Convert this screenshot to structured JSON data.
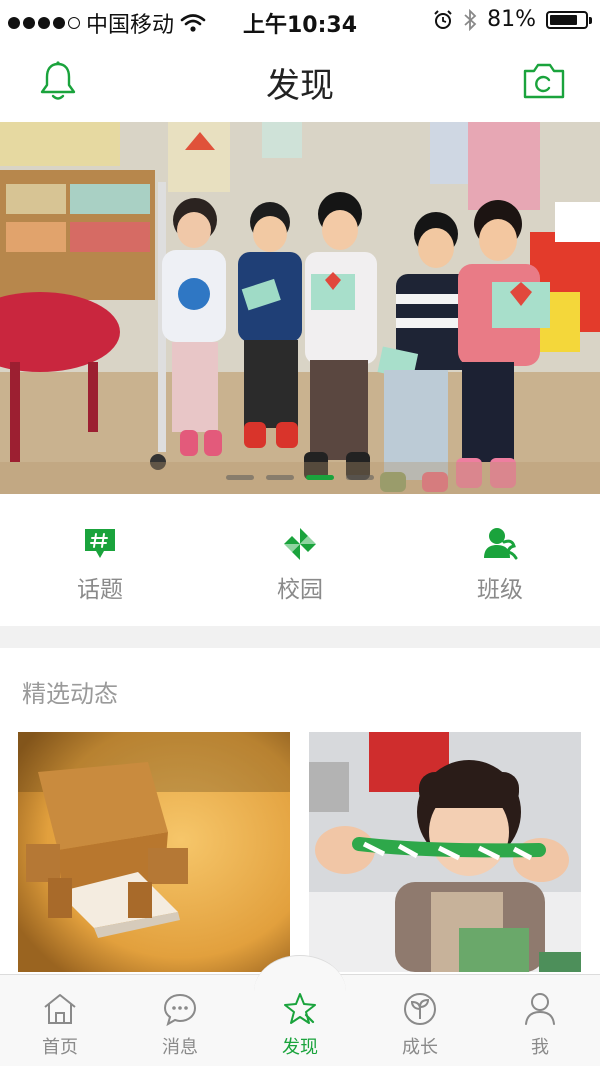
{
  "status_bar": {
    "carrier": "中国移动",
    "time": "上午10:34",
    "battery_percent": "81%",
    "battery_level": 0.81,
    "signal_bars_filled": 4,
    "signal_bars_total": 5
  },
  "nav_bar": {
    "title": "发现",
    "left_icon": "bell-icon",
    "right_icon": "camera-icon"
  },
  "banner": {
    "slide_count": 4,
    "active_slide": 3
  },
  "quick_entries": [
    {
      "label": "话题",
      "icon": "topic-hash-icon"
    },
    {
      "label": "校园",
      "icon": "campus-pinwheel-icon"
    },
    {
      "label": "班级",
      "icon": "class-person-icon"
    }
  ],
  "featured": {
    "title": "精选动态"
  },
  "tab_bar": {
    "items": [
      {
        "label": "首页",
        "icon": "home-icon"
      },
      {
        "label": "消息",
        "icon": "message-icon"
      },
      {
        "label": "发现",
        "icon": "discover-star-icon",
        "active": true
      },
      {
        "label": "成长",
        "icon": "sprout-icon"
      },
      {
        "label": "我",
        "icon": "user-icon"
      }
    ]
  },
  "colors": {
    "accent": "#1aa33c",
    "inactive": "#8a8a8a"
  }
}
